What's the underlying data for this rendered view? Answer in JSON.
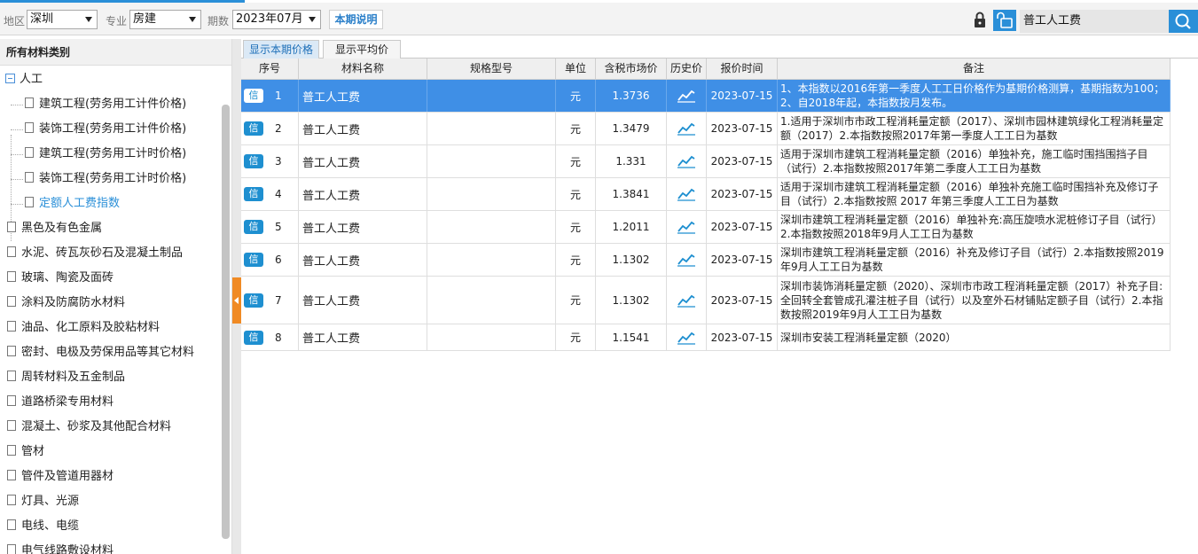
{
  "toolbar": {
    "region_label": "地区",
    "region_value": "深圳",
    "major_label": "专业",
    "major_value": "房建",
    "period_label": "期数",
    "period_value": "2023年07月",
    "explain_button": "本期说明",
    "search_value": "普工人工费"
  },
  "sidebar": {
    "header": "所有材料类别",
    "root": "人工",
    "children": [
      "建筑工程(劳务用工计件价格)",
      "装饰工程(劳务用工计件价格)",
      "建筑工程(劳务用工计时价格)",
      "装饰工程(劳务用工计时价格)",
      "定额人工费指数"
    ],
    "categories": [
      "黑色及有色金属",
      "水泥、砖瓦灰砂石及混凝土制品",
      "玻璃、陶瓷及面砖",
      "涂料及防腐防水材料",
      "油品、化工原料及胶粘材料",
      "密封、电极及劳保用品等其它材料",
      "周转材料及五金制品",
      "道路桥梁专用材料",
      "混凝土、砂浆及其他配合材料",
      "管材",
      "管件及管道用器材",
      "灯具、光源",
      "电线、电缆",
      "电气线路敷设材料"
    ]
  },
  "tabs": [
    "显示本期价格",
    "显示平均价"
  ],
  "grid": {
    "columns": [
      "序号",
      "材料名称",
      "规格型号",
      "单位",
      "含税市场价",
      "历史价",
      "报价时间",
      "备注"
    ],
    "badge": "信",
    "rows": [
      {
        "seq": "1",
        "name": "普工人工费",
        "spec": "",
        "unit": "元",
        "price": "1.3736",
        "date": "2023-07-15",
        "note": "1、本指数以2016年第一季度人工工日价格作为基期价格测算，基期指数为100；2、自2018年起，本指数按月发布。"
      },
      {
        "seq": "2",
        "name": "普工人工费",
        "spec": "",
        "unit": "元",
        "price": "1.3479",
        "date": "2023-07-15",
        "note": "1.适用于深圳市市政工程消耗量定额（2017）、深圳市园林建筑绿化工程消耗量定额（2017）2.本指数按照2017年第一季度人工工日为基数"
      },
      {
        "seq": "3",
        "name": "普工人工费",
        "spec": "",
        "unit": "元",
        "price": "1.331",
        "date": "2023-07-15",
        "note": "适用于深圳市建筑工程消耗量定额（2016）单独补充，施工临时围挡围挡子目（试行）2.本指数按照2017年第二季度人工工日为基数"
      },
      {
        "seq": "4",
        "name": "普工人工费",
        "spec": "",
        "unit": "元",
        "price": "1.3841",
        "date": "2023-07-15",
        "note": "适用于深圳市建筑工程消耗量定额（2016）单独补充施工临时围挡补充及修订子目（试行）2.本指数按照 2017 年第三季度人工工日为基数"
      },
      {
        "seq": "5",
        "name": "普工人工费",
        "spec": "",
        "unit": "元",
        "price": "1.2011",
        "date": "2023-07-15",
        "note": "深圳市建筑工程消耗量定额（2016）单独补充:高压旋喷水泥桩修订子目（试行）2.本指数按照2018年9月人工工日为基数"
      },
      {
        "seq": "6",
        "name": "普工人工费",
        "spec": "",
        "unit": "元",
        "price": "1.1302",
        "date": "2023-07-15",
        "note": "深圳市建筑工程消耗量定额（2016）补充及修订子目（试行）2.本指数按照2019年9月人工工日为基数"
      },
      {
        "seq": "7",
        "name": "普工人工费",
        "spec": "",
        "unit": "元",
        "price": "1.1302",
        "date": "2023-07-15",
        "note": "深圳市装饰消耗量定额（2020）、深圳市市政工程消耗量定额（2017）补充子目:全回转全套管成孔灌注桩子目（试行）以及室外石材铺贴定额子目（试行）2.本指数按照2019年9月人工工日为基数"
      },
      {
        "seq": "8",
        "name": "普工人工费",
        "spec": "",
        "unit": "元",
        "price": "1.1541",
        "date": "2023-07-15",
        "note": "深圳市安装工程消耗量定额（2020）"
      }
    ]
  }
}
